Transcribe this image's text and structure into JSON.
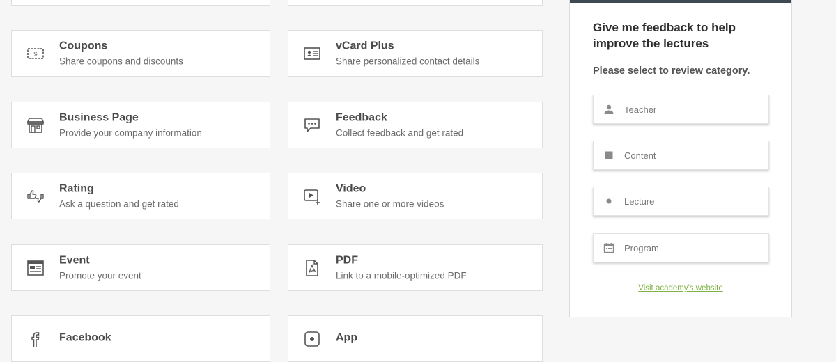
{
  "cards": [
    {
      "title": "Coupons",
      "subtitle": "Share coupons and discounts",
      "icon": "coupon-icon"
    },
    {
      "title": "vCard Plus",
      "subtitle": "Share personalized contact details",
      "icon": "contact-card-icon"
    },
    {
      "title": "Business Page",
      "subtitle": "Provide your company information",
      "icon": "storefront-icon"
    },
    {
      "title": "Feedback",
      "subtitle": "Collect feedback and get rated",
      "icon": "chat-bubble-icon"
    },
    {
      "title": "Rating",
      "subtitle": "Ask a question and get rated",
      "icon": "thumbs-icon"
    },
    {
      "title": "Video",
      "subtitle": "Share one or more videos",
      "icon": "video-icon"
    },
    {
      "title": "Event",
      "subtitle": "Promote your event",
      "icon": "calendar-event-icon"
    },
    {
      "title": "PDF",
      "subtitle": "Link to a mobile-optimized PDF",
      "icon": "pdf-icon"
    },
    {
      "title": "Facebook",
      "subtitle": "",
      "icon": "facebook-icon"
    },
    {
      "title": "App",
      "subtitle": "",
      "icon": "app-icon"
    }
  ],
  "feedback_panel": {
    "title": "Give me feedback to help improve the lectures",
    "prompt": "Please select to review category.",
    "options": [
      {
        "label": "Teacher",
        "icon": "person-icon"
      },
      {
        "label": "Content",
        "icon": "square-icon"
      },
      {
        "label": "Lecture",
        "icon": "dot-icon"
      },
      {
        "label": "Program",
        "icon": "calendar-icon"
      }
    ],
    "link": "Visit academy's website",
    "accent_color": "#7cb342",
    "bar_color": "#3d4a55"
  }
}
